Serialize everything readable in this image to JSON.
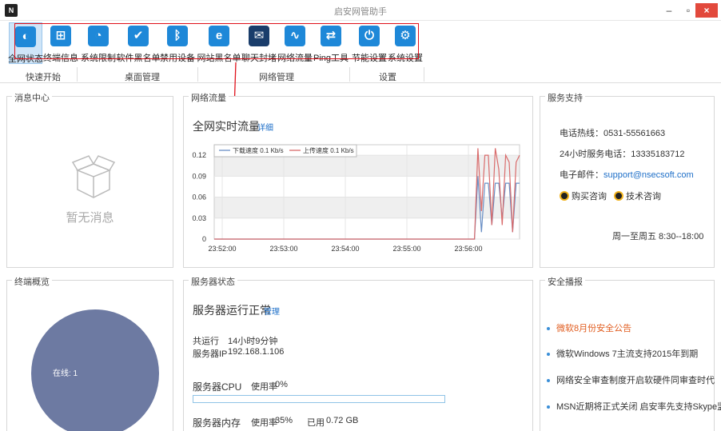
{
  "window": {
    "title": "启安网管助手",
    "logo_text": "N",
    "minimize_glyph": "–",
    "maximize_glyph": "▫",
    "close_glyph": "×"
  },
  "toolbar": {
    "tools": [
      {
        "label": "全网状态",
        "icon": "globe-icon",
        "glyph": "◐"
      },
      {
        "label": "终端信息",
        "icon": "windows-icon",
        "glyph": "⊞"
      },
      {
        "label": "系统限制",
        "icon": "shield-icon",
        "glyph": "◔"
      },
      {
        "label": "软件黑名单",
        "icon": "check-icon",
        "glyph": "✔"
      },
      {
        "label": "禁用设备",
        "icon": "bluetooth-icon",
        "glyph": "ᛒ"
      },
      {
        "label": "网站黑名单",
        "icon": "ie-icon",
        "glyph": "e"
      },
      {
        "label": "聊天封堵",
        "icon": "chat-block-icon",
        "glyph": "✉"
      },
      {
        "label": "网络流量",
        "icon": "pulse-icon",
        "glyph": "∿"
      },
      {
        "label": "Ping工具",
        "icon": "transfer-icon",
        "glyph": "⇄"
      },
      {
        "label": "节能设置",
        "icon": "power-icon",
        "glyph": "⏻"
      },
      {
        "label": "系统设置",
        "icon": "gear-icon",
        "glyph": "⚙"
      }
    ],
    "groups": [
      "快速开始",
      "桌面管理",
      "网络管理",
      "设置"
    ]
  },
  "message_center": {
    "title": "消息中心",
    "empty_text": "暂无消息"
  },
  "traffic": {
    "title": "网络流量",
    "heading": "全网实时流量",
    "detail_link": "详细"
  },
  "chart_data": {
    "type": "line",
    "x": [
      "23:52:00",
      "23:53:00",
      "23:54:00",
      "23:55:00",
      "23:56:00"
    ],
    "ylim": [
      0,
      0.135
    ],
    "yticks": [
      "0.12",
      "0.09",
      "0.06",
      "0.03",
      "0"
    ],
    "legend_placement": "top-left",
    "series": [
      {
        "name": "下载速度 0.1 Kb/s",
        "color": "#6a8fc5",
        "values": [
          0,
          0,
          0,
          0,
          0,
          0,
          0,
          0,
          0,
          0,
          0,
          0,
          0,
          0,
          0,
          0,
          0,
          0,
          0,
          0,
          0,
          0,
          0,
          0,
          0,
          0,
          0,
          0,
          0,
          0,
          0,
          0,
          0,
          0,
          0,
          0,
          0,
          0,
          0,
          0,
          0,
          0,
          0,
          0,
          0,
          0,
          0,
          0,
          0,
          0,
          0,
          0,
          0,
          0,
          0,
          0,
          0,
          0,
          0,
          0,
          0,
          0,
          0,
          0,
          0,
          0,
          0,
          0,
          0,
          0,
          0,
          0,
          0,
          0,
          0,
          0,
          0.09,
          0.01,
          0.08,
          0.08,
          0.02,
          0.08,
          0.08,
          0.03,
          0.08,
          0.08,
          0.01,
          0.08,
          0.08
        ]
      },
      {
        "name": "上传速度 0.1 Kb/s",
        "color": "#d96b6b",
        "values": [
          0,
          0,
          0,
          0,
          0,
          0,
          0,
          0,
          0,
          0,
          0,
          0,
          0,
          0,
          0,
          0,
          0,
          0,
          0,
          0,
          0,
          0,
          0,
          0,
          0,
          0,
          0,
          0,
          0,
          0,
          0,
          0,
          0,
          0,
          0,
          0,
          0,
          0,
          0,
          0,
          0,
          0,
          0,
          0,
          0,
          0,
          0,
          0,
          0,
          0,
          0,
          0,
          0,
          0,
          0,
          0,
          0,
          0,
          0,
          0,
          0,
          0,
          0,
          0,
          0,
          0,
          0,
          0,
          0,
          0,
          0,
          0,
          0,
          0,
          0,
          0,
          0.13,
          0.04,
          0.12,
          0.12,
          0.02,
          0.13,
          0.1,
          0.02,
          0.12,
          0.11,
          0.01,
          0.11,
          0.12
        ]
      }
    ]
  },
  "support": {
    "title": "服务支持",
    "hotline": "电话热线：0531-55561663",
    "hotline24": "24小时服务电话：13335183712",
    "email_label": "电子邮件：",
    "email": "support@nsecsoft.com",
    "buy_consult": "购买咨询",
    "tech_consult": "技术咨询",
    "hours": "周一至周五 8:30--18:00"
  },
  "terminal": {
    "title": "终端概览",
    "online_label": "在线: 1",
    "pie_color": "#6d7aa2",
    "online_count": 1
  },
  "server": {
    "title": "服务器状态",
    "heading": "服务器运行正常",
    "manage_link": "管理",
    "uptime_label": "共运行",
    "uptime_value": "14小时9分钟",
    "ip_label": "服务器IP",
    "ip_value": "192.168.1.106",
    "cpu_label": "服务器CPU",
    "cpu_usage_label": "使用率",
    "cpu_usage_value": "0%",
    "cpu_fraction": 0,
    "mem_label": "服务器内存",
    "mem_usage_label": "使用率",
    "mem_usage_value": "35%",
    "mem_used_label": "已用",
    "mem_used_value": "0.72 GB"
  },
  "news": {
    "title": "安全播报",
    "items": [
      "微软8月份安全公告",
      "微软Windows 7主流支持2015年到期",
      "网络安全审查制度开启软硬件同审查时代",
      "MSN近期将正式关闭 启安率先支持Skype监控"
    ]
  },
  "colors": {
    "accent": "#1e88d8",
    "highlight_box": "#e0101a",
    "link": "#1e6fc8",
    "news_hot": "#e05a1c"
  }
}
